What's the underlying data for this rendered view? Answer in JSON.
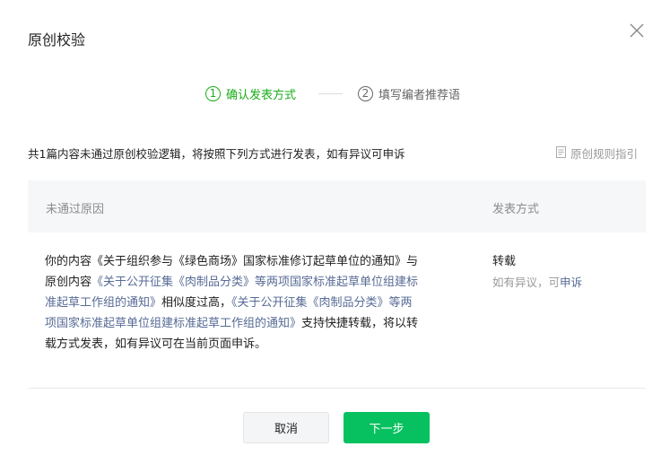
{
  "dialog": {
    "title": "原创校验",
    "steps": [
      {
        "num": "1",
        "label": "确认发表方式"
      },
      {
        "num": "2",
        "label": "填写编者推荐语"
      }
    ],
    "notice": "共1篇内容未通过原创校验逻辑，将按照下列方式进行发表，如有异议可申诉",
    "rules_link": "原创规则指引",
    "table": {
      "headers": [
        "未通过原因",
        "发表方式"
      ],
      "row": {
        "reason_parts": [
          "你的内容《关于组织参与《绿色商场》国家标准修订起草单位的通知》与原创内容",
          "《关于公开征集《肉制品分类》等两项国家标准起草单位组建标准起草工作组的通知》",
          "相似度过高，",
          "《关于公开征集《肉制品分类》等两项国家标准起草单位组建标准起草工作组的通知》",
          "支持快捷转载，将以转载方式发表，如有异议可在当前页面申诉。"
        ],
        "method": "转载",
        "method_sub_prefix": "如有异议，可",
        "method_sub_link": "申诉"
      }
    },
    "buttons": {
      "cancel": "取消",
      "next": "下一步"
    }
  },
  "colors": {
    "accent_green": "#07c160",
    "step_active": "#1aad19",
    "link_blue": "#576b95"
  },
  "icons": [
    "close-icon",
    "document-icon"
  ]
}
